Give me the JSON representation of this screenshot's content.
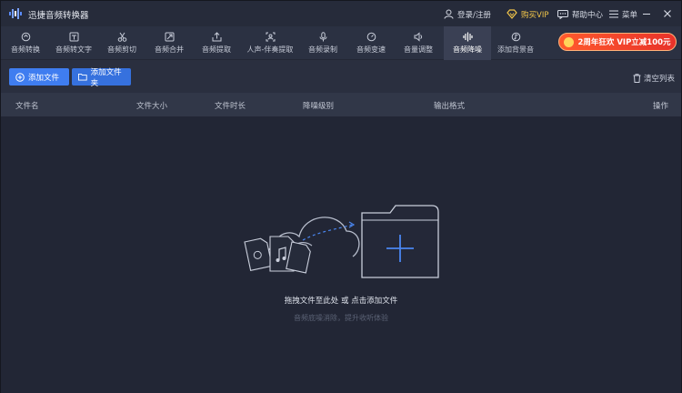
{
  "app": {
    "title": "迅捷音频转换器"
  },
  "titlebar": {
    "login_label": "登录/注册",
    "vip_label": "购买VIP",
    "help_label": "帮助中心",
    "menu_label": "菜单"
  },
  "toolbar": {
    "tools": [
      {
        "label": "音频转换",
        "icon": "refresh-icon"
      },
      {
        "label": "音频转文字",
        "icon": "text-icon"
      },
      {
        "label": "音频剪切",
        "icon": "scissors-icon"
      },
      {
        "label": "音频合并",
        "icon": "merge-icon"
      },
      {
        "label": "音频提取",
        "icon": "extract-icon"
      },
      {
        "label": "人声-伴奏提取",
        "icon": "voice-icon"
      },
      {
        "label": "音频录制",
        "icon": "mic-icon"
      },
      {
        "label": "音频变速",
        "icon": "speed-icon"
      },
      {
        "label": "音量调整",
        "icon": "volume-icon"
      },
      {
        "label": "音频降噪",
        "icon": "waveform-icon"
      },
      {
        "label": "添加背景音",
        "icon": "music-icon"
      }
    ],
    "active_tool": "音频降噪",
    "promo_label": "2周年狂欢 VIP立减100元"
  },
  "actions": {
    "add_file_label": "添加文件",
    "add_folder_label": "添加文件夹",
    "clear_list_label": "清空列表"
  },
  "table": {
    "columns": [
      "文件名",
      "文件大小",
      "文件时长",
      "降噪级别",
      "输出格式",
      "操作"
    ]
  },
  "dropzone": {
    "main_text": "拖拽文件至此处 或 点击添加文件",
    "sub_text": "音频底噪消除，提升收听体验"
  },
  "colors": {
    "accent": "#3f7df0",
    "vip": "#f3c64a",
    "promo": "#e8322a"
  }
}
